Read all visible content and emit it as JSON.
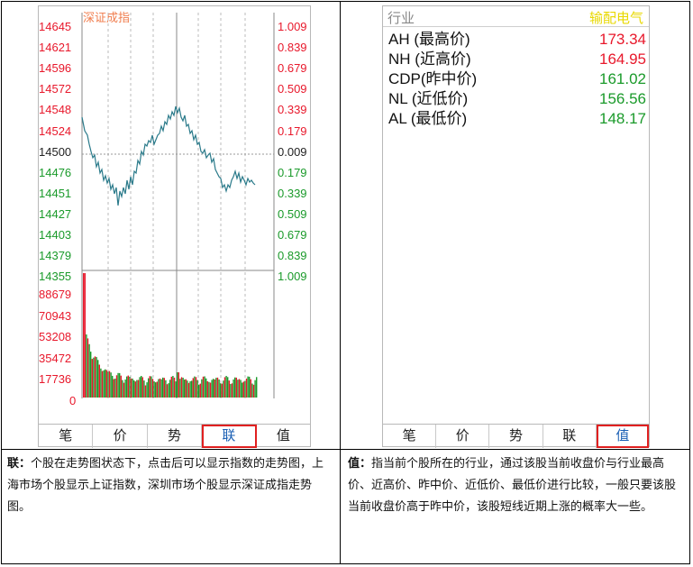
{
  "left_panel": {
    "title": "深证成指",
    "price_ticks": [
      "14645",
      "14621",
      "14596",
      "14572",
      "14548",
      "14524",
      "14500",
      "14476",
      "14451",
      "14427",
      "14403",
      "14379",
      "14355"
    ],
    "pct_ticks": [
      "1.009",
      "0.839",
      "0.679",
      "0.509",
      "0.339",
      "0.179",
      "0.009",
      "0.179",
      "0.339",
      "0.509",
      "0.679",
      "0.839",
      "1.009"
    ],
    "volume_ticks": [
      "88679",
      "70943",
      "53208",
      "35472",
      "17736",
      "0"
    ],
    "tabs": [
      {
        "label": "笔",
        "active": false
      },
      {
        "label": "价",
        "active": false
      },
      {
        "label": "势",
        "active": false
      },
      {
        "label": "联",
        "active": true
      },
      {
        "label": "值",
        "active": false
      }
    ]
  },
  "right_panel": {
    "industry_label": "行业",
    "stock_name": "输配电气",
    "rows": [
      {
        "label": "AH (最高价)",
        "value": "173.34",
        "color": "#e8182b"
      },
      {
        "label": "NH (近高价)",
        "value": "164.95",
        "color": "#e8182b"
      },
      {
        "label": "CDP(昨中价)",
        "value": "161.02",
        "color": "#1a9a2a"
      },
      {
        "label": "NL (近低价)",
        "value": "156.56",
        "color": "#1a9a2a"
      },
      {
        "label": "AL (最低价)",
        "value": "148.17",
        "color": "#1a9a2a"
      }
    ],
    "tabs": [
      {
        "label": "笔",
        "active": false
      },
      {
        "label": "价",
        "active": false
      },
      {
        "label": "势",
        "active": false
      },
      {
        "label": "联",
        "active": false
      },
      {
        "label": "值",
        "active": true
      }
    ]
  },
  "notes": {
    "left_term": "联：",
    "left_text": "个股在走势图状态下，点击后可以显示指数的走势图，上海市场个股显示上证指数，深圳市场个股显示深证成指走势图。",
    "right_term": "值：",
    "right_text": "指当前个股所在的行业，通过该股当前收盘价与行业最高价、近高价、昨中价、近低价、最低价进行比较，一般只要该股当前收盘价高于昨中价，该股短线近期上涨的概率大一些。"
  },
  "colors": {
    "up": "#e8182b",
    "down": "#1a9a2a",
    "line": "#2a7a8a",
    "tab_highlight": "#e02020"
  }
}
